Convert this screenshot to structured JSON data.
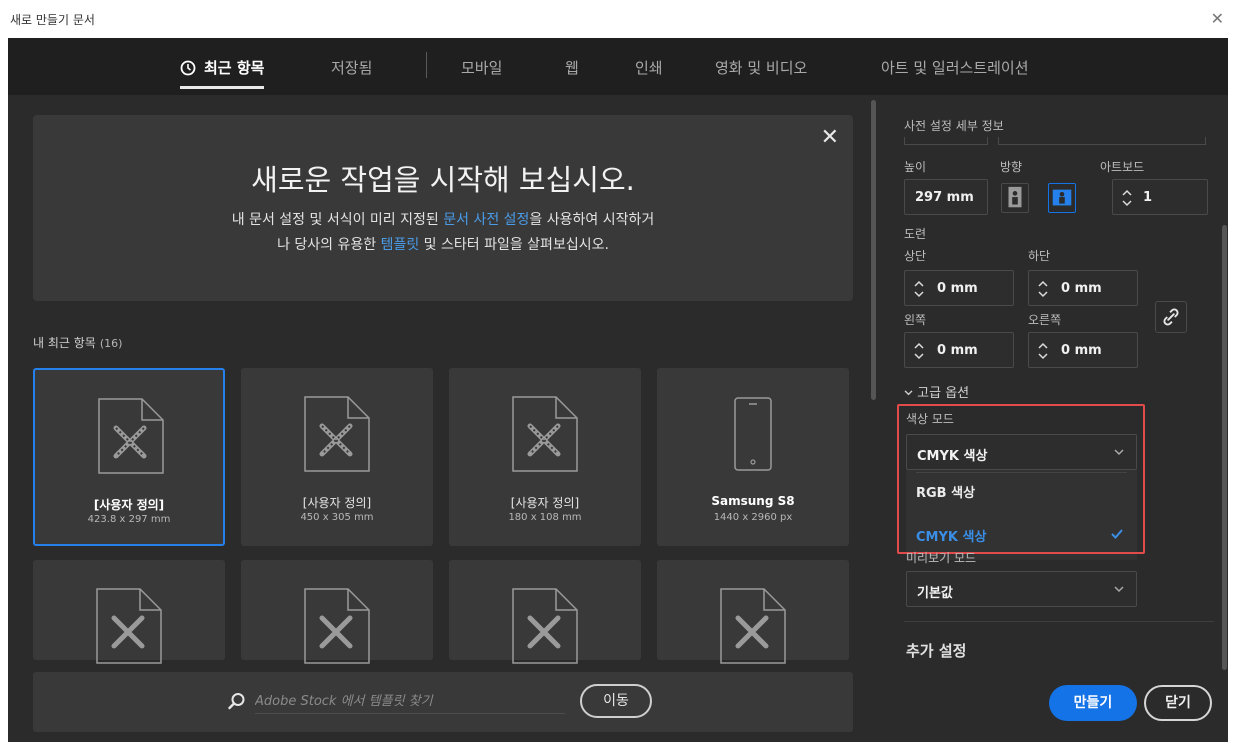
{
  "window": {
    "title": "새로 만들기 문서",
    "close_glyph": "✕"
  },
  "tabs": [
    {
      "label": "최근 항목",
      "active": true
    },
    {
      "label": "저장됨"
    },
    {
      "label": "모바일"
    },
    {
      "label": "웹"
    },
    {
      "label": "인쇄"
    },
    {
      "label": "영화 및 비디오"
    },
    {
      "label": "아트 및 일러스트레이션"
    }
  ],
  "welcome": {
    "close_glyph": "✕",
    "headline": "새로운 작업을 시작해 보십시오.",
    "line1_before": "내 문서 설정 및 서식이 미리 지정된 ",
    "line1_link": "문서 사전 설정",
    "line1_after": "을 사용하여 시작하거",
    "line2_before": "나 당사의 유용한 ",
    "line2_link": "템플릿",
    "line2_after": " 및 스타터 파일을 살펴보십시오."
  },
  "recent": {
    "label": "내 최근 항목",
    "count": "(16)",
    "tiles": [
      {
        "name": "[사용자 정의]",
        "size": "423.8 x 297 mm",
        "icon": "document-ruler-icon",
        "selected": true
      },
      {
        "name": "[사용자 정의]",
        "size": "450 x 305 mm",
        "icon": "document-ruler-icon"
      },
      {
        "name": "[사용자 정의]",
        "size": "180 x 108 mm",
        "icon": "document-ruler-icon"
      },
      {
        "name": "Samsung S8",
        "size": "1440 x 2960 px",
        "icon": "phone-icon"
      }
    ]
  },
  "stock_search": {
    "placeholder": "Adobe Stock 에서 템플릿 찾기",
    "go_label": "이동"
  },
  "panel": {
    "section_title": "사전 설정 세부 정보",
    "height_label": "높이",
    "height_value": "297 mm",
    "orientation_label": "방향",
    "artboard_label": "아트보드",
    "artboard_value": "1",
    "bleed_label": "도련",
    "top_label": "상단",
    "top_value": "0 mm",
    "bottom_label": "하단",
    "bottom_value": "0 mm",
    "left_label": "왼쪽",
    "left_value": "0 mm",
    "right_label": "오른쪽",
    "right_value": "0 mm",
    "advanced_label": "고급 옵션",
    "color_mode_label": "색상 모드",
    "color_mode_value": "CMYK 색상",
    "color_mode_options": [
      "RGB 색상",
      "CMYK 색상"
    ],
    "preview_mode_label": "미리보기 모드",
    "preview_mode_value": "기본값",
    "more_settings": "추가 설정",
    "create_label": "만들기",
    "close_label": "닫기"
  },
  "colors": {
    "accent": "#1473e6",
    "link": "#4a9ce8",
    "highlight": "#e24b4b",
    "selected_border": "#2680eb"
  }
}
